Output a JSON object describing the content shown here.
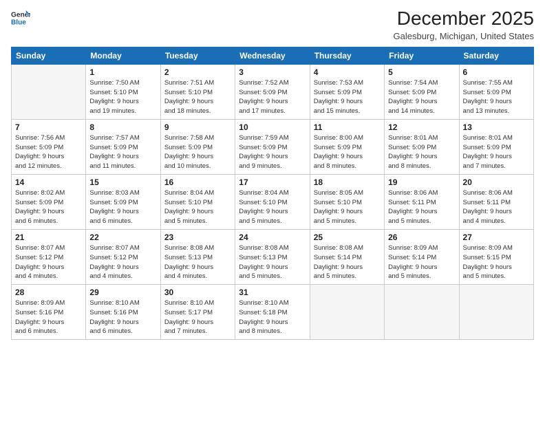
{
  "logo": {
    "line1": "General",
    "line2": "Blue"
  },
  "title": "December 2025",
  "location": "Galesburg, Michigan, United States",
  "weekdays": [
    "Sunday",
    "Monday",
    "Tuesday",
    "Wednesday",
    "Thursday",
    "Friday",
    "Saturday"
  ],
  "weeks": [
    [
      {
        "day": "",
        "info": ""
      },
      {
        "day": "1",
        "info": "Sunrise: 7:50 AM\nSunset: 5:10 PM\nDaylight: 9 hours\nand 19 minutes."
      },
      {
        "day": "2",
        "info": "Sunrise: 7:51 AM\nSunset: 5:10 PM\nDaylight: 9 hours\nand 18 minutes."
      },
      {
        "day": "3",
        "info": "Sunrise: 7:52 AM\nSunset: 5:09 PM\nDaylight: 9 hours\nand 17 minutes."
      },
      {
        "day": "4",
        "info": "Sunrise: 7:53 AM\nSunset: 5:09 PM\nDaylight: 9 hours\nand 15 minutes."
      },
      {
        "day": "5",
        "info": "Sunrise: 7:54 AM\nSunset: 5:09 PM\nDaylight: 9 hours\nand 14 minutes."
      },
      {
        "day": "6",
        "info": "Sunrise: 7:55 AM\nSunset: 5:09 PM\nDaylight: 9 hours\nand 13 minutes."
      }
    ],
    [
      {
        "day": "7",
        "info": "Sunrise: 7:56 AM\nSunset: 5:09 PM\nDaylight: 9 hours\nand 12 minutes."
      },
      {
        "day": "8",
        "info": "Sunrise: 7:57 AM\nSunset: 5:09 PM\nDaylight: 9 hours\nand 11 minutes."
      },
      {
        "day": "9",
        "info": "Sunrise: 7:58 AM\nSunset: 5:09 PM\nDaylight: 9 hours\nand 10 minutes."
      },
      {
        "day": "10",
        "info": "Sunrise: 7:59 AM\nSunset: 5:09 PM\nDaylight: 9 hours\nand 9 minutes."
      },
      {
        "day": "11",
        "info": "Sunrise: 8:00 AM\nSunset: 5:09 PM\nDaylight: 9 hours\nand 8 minutes."
      },
      {
        "day": "12",
        "info": "Sunrise: 8:01 AM\nSunset: 5:09 PM\nDaylight: 9 hours\nand 8 minutes."
      },
      {
        "day": "13",
        "info": "Sunrise: 8:01 AM\nSunset: 5:09 PM\nDaylight: 9 hours\nand 7 minutes."
      }
    ],
    [
      {
        "day": "14",
        "info": "Sunrise: 8:02 AM\nSunset: 5:09 PM\nDaylight: 9 hours\nand 6 minutes."
      },
      {
        "day": "15",
        "info": "Sunrise: 8:03 AM\nSunset: 5:09 PM\nDaylight: 9 hours\nand 6 minutes."
      },
      {
        "day": "16",
        "info": "Sunrise: 8:04 AM\nSunset: 5:10 PM\nDaylight: 9 hours\nand 5 minutes."
      },
      {
        "day": "17",
        "info": "Sunrise: 8:04 AM\nSunset: 5:10 PM\nDaylight: 9 hours\nand 5 minutes."
      },
      {
        "day": "18",
        "info": "Sunrise: 8:05 AM\nSunset: 5:10 PM\nDaylight: 9 hours\nand 5 minutes."
      },
      {
        "day": "19",
        "info": "Sunrise: 8:06 AM\nSunset: 5:11 PM\nDaylight: 9 hours\nand 5 minutes."
      },
      {
        "day": "20",
        "info": "Sunrise: 8:06 AM\nSunset: 5:11 PM\nDaylight: 9 hours\nand 4 minutes."
      }
    ],
    [
      {
        "day": "21",
        "info": "Sunrise: 8:07 AM\nSunset: 5:12 PM\nDaylight: 9 hours\nand 4 minutes."
      },
      {
        "day": "22",
        "info": "Sunrise: 8:07 AM\nSunset: 5:12 PM\nDaylight: 9 hours\nand 4 minutes."
      },
      {
        "day": "23",
        "info": "Sunrise: 8:08 AM\nSunset: 5:13 PM\nDaylight: 9 hours\nand 4 minutes."
      },
      {
        "day": "24",
        "info": "Sunrise: 8:08 AM\nSunset: 5:13 PM\nDaylight: 9 hours\nand 5 minutes."
      },
      {
        "day": "25",
        "info": "Sunrise: 8:08 AM\nSunset: 5:14 PM\nDaylight: 9 hours\nand 5 minutes."
      },
      {
        "day": "26",
        "info": "Sunrise: 8:09 AM\nSunset: 5:14 PM\nDaylight: 9 hours\nand 5 minutes."
      },
      {
        "day": "27",
        "info": "Sunrise: 8:09 AM\nSunset: 5:15 PM\nDaylight: 9 hours\nand 5 minutes."
      }
    ],
    [
      {
        "day": "28",
        "info": "Sunrise: 8:09 AM\nSunset: 5:16 PM\nDaylight: 9 hours\nand 6 minutes."
      },
      {
        "day": "29",
        "info": "Sunrise: 8:10 AM\nSunset: 5:16 PM\nDaylight: 9 hours\nand 6 minutes."
      },
      {
        "day": "30",
        "info": "Sunrise: 8:10 AM\nSunset: 5:17 PM\nDaylight: 9 hours\nand 7 minutes."
      },
      {
        "day": "31",
        "info": "Sunrise: 8:10 AM\nSunset: 5:18 PM\nDaylight: 9 hours\nand 8 minutes."
      },
      {
        "day": "",
        "info": ""
      },
      {
        "day": "",
        "info": ""
      },
      {
        "day": "",
        "info": ""
      }
    ]
  ]
}
